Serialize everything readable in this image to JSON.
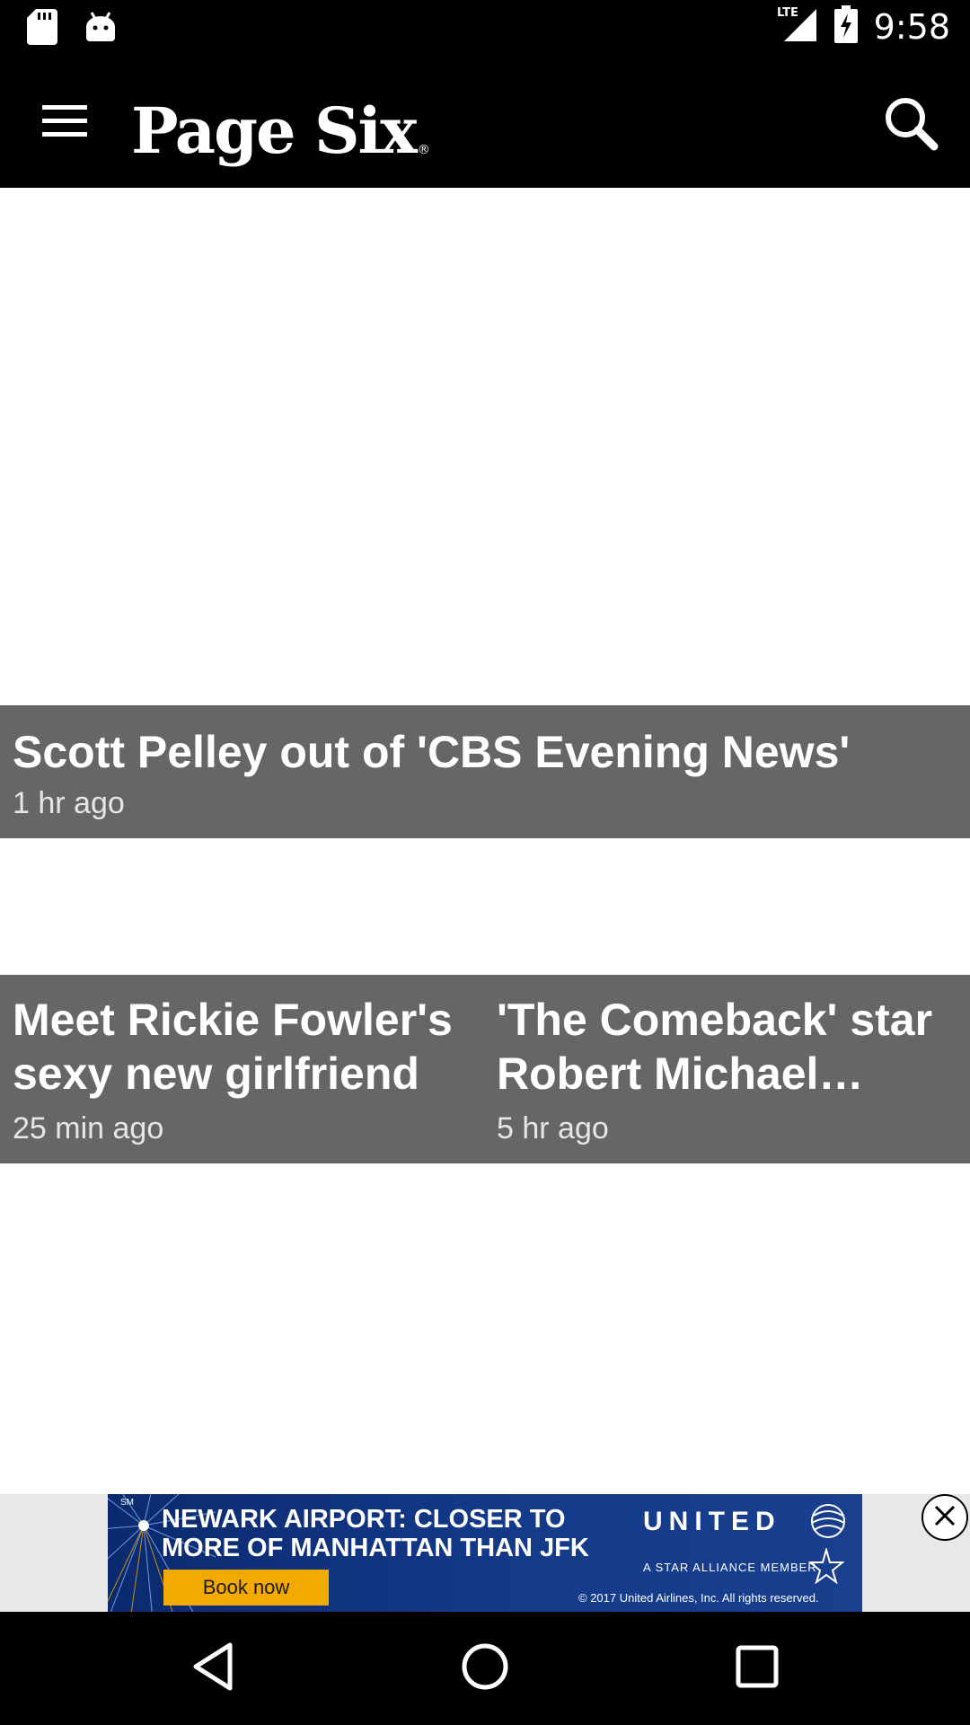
{
  "status_bar": {
    "time": "9:58",
    "network": "LTE",
    "icons": [
      "sd-card-icon",
      "android-icon",
      "lte-signal-icon",
      "battery-charging-icon"
    ]
  },
  "app_bar": {
    "logo_text": "Page Six",
    "logo_mark": "®",
    "icons": [
      "menu-icon",
      "search-icon"
    ]
  },
  "feed": {
    "hero": {
      "headline": "Scott Pelley out of 'CBS Evening News'",
      "time": "1 hr ago"
    },
    "cards": [
      {
        "headline": "Meet Rickie Fowler's sexy new girlfriend",
        "time": "25 min ago"
      },
      {
        "headline": "'The Comeback' star Robert Michael…",
        "time": "5 hr ago"
      }
    ]
  },
  "ad": {
    "sm_mark": "SM",
    "headline": "NEWARK AIRPORT: CLOSER TO MORE OF MANHATTAN THAN JFK",
    "cta": "Book now",
    "brand": "UNITED",
    "alliance": "A STAR ALLIANCE MEMBER",
    "copyright": "© 2017 United Airlines, Inc. All rights reserved.",
    "colors": {
      "background": "#0b2a6e",
      "cta": "#f2a900"
    }
  },
  "nav_bar": {
    "icons": [
      "back-icon",
      "home-icon",
      "recents-icon"
    ]
  },
  "colors": {
    "bar_background": "#000000",
    "caption_background": "#666666"
  }
}
